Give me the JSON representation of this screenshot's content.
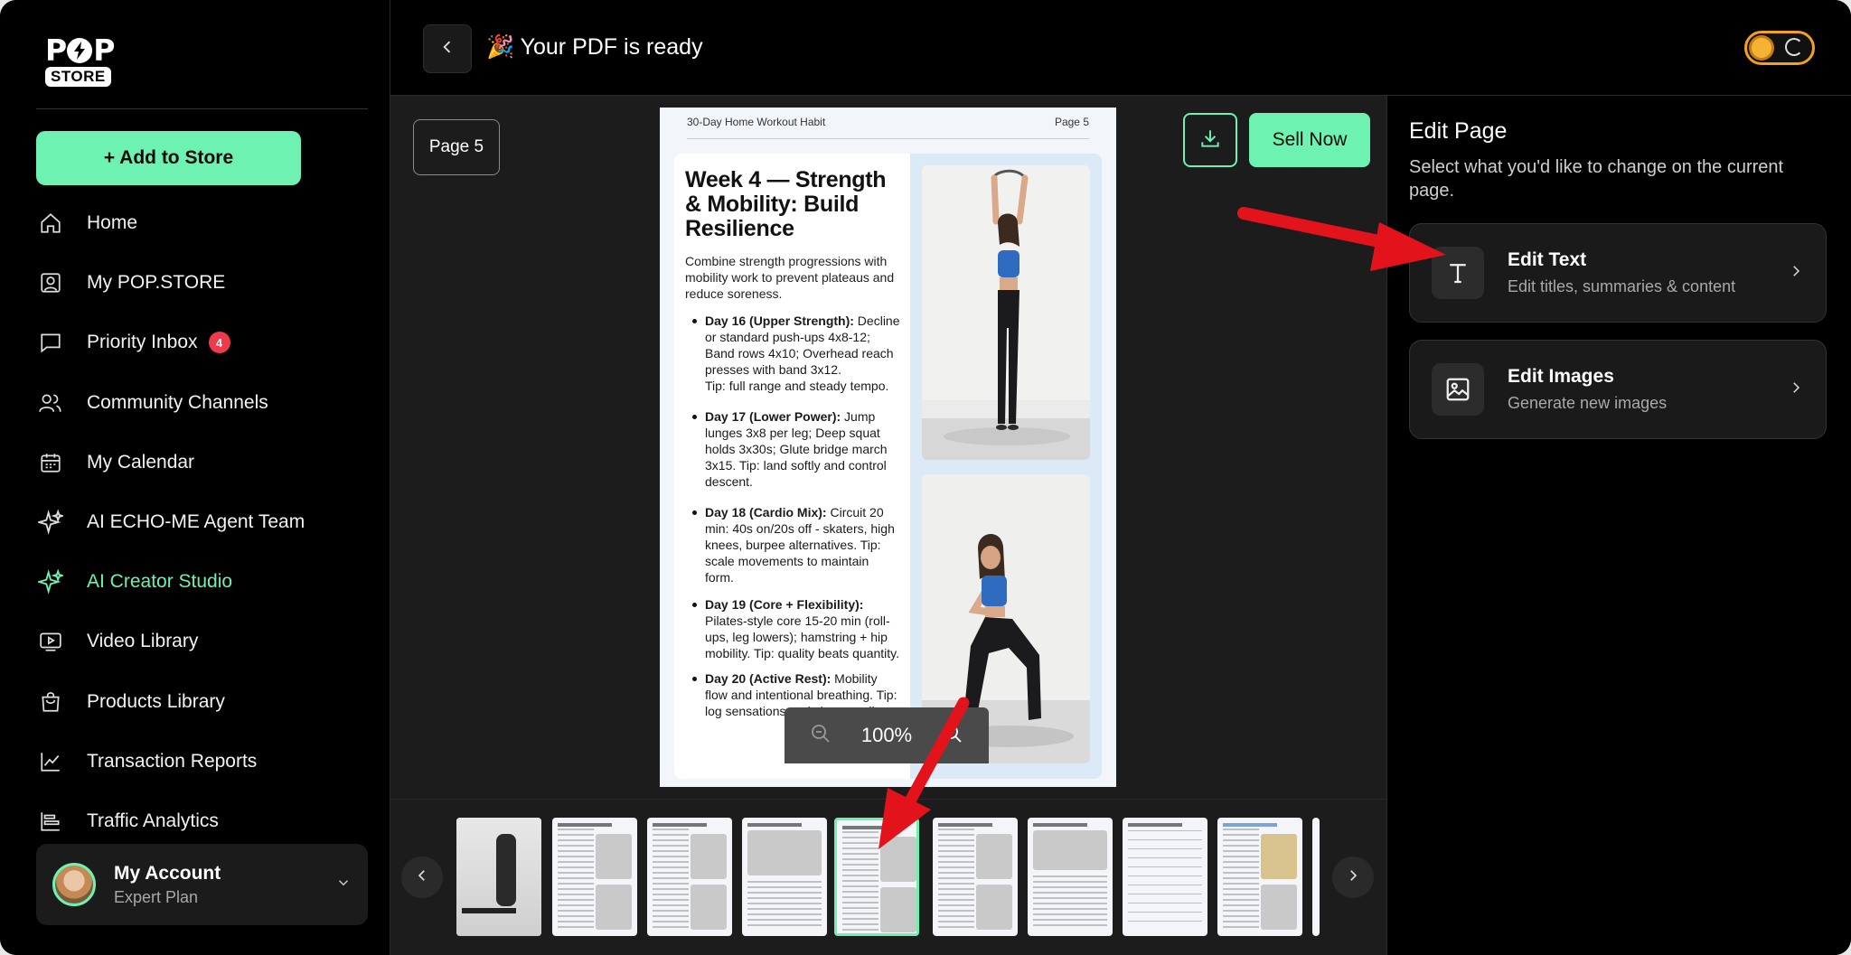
{
  "brand": {
    "logo_top": "POP",
    "logo_bottom": "STORE"
  },
  "sidebar": {
    "add_button": "+ Add to Store",
    "items": [
      {
        "label": "Home",
        "icon": "home-icon"
      },
      {
        "label": "My POP.STORE",
        "icon": "store-profile-icon"
      },
      {
        "label": "Priority Inbox",
        "icon": "chat-icon",
        "badge": "4"
      },
      {
        "label": "Community Channels",
        "icon": "users-icon"
      },
      {
        "label": "My Calendar",
        "icon": "calendar-icon"
      },
      {
        "label": "AI ECHO-ME Agent Team",
        "icon": "sparkle-icon"
      },
      {
        "label": "AI Creator Studio",
        "icon": "sparkle-icon",
        "active": true
      },
      {
        "label": "Video Library",
        "icon": "video-icon"
      },
      {
        "label": "Products Library",
        "icon": "bag-icon"
      },
      {
        "label": "Transaction Reports",
        "icon": "chart-line-icon"
      },
      {
        "label": "Traffic Analytics",
        "icon": "bar-chart-icon"
      }
    ],
    "account": {
      "name": "My Account",
      "plan": "Expert Plan"
    }
  },
  "topbar": {
    "title": "🎉 Your PDF is ready"
  },
  "viewer": {
    "page_chip": "Page 5",
    "sell_button": "Sell Now",
    "zoom": "100%"
  },
  "pdf": {
    "header_left": "30-Day Home Workout Habit",
    "header_right": "Page 5",
    "title": "Week 4 — Strength & Mobility: Build Resilience",
    "lead": "Combine strength progressions with mobility work to prevent plateaus and reduce soreness.",
    "items": [
      {
        "bold": "Day 16 (Upper Strength):",
        "text": " Decline or standard push-ups 4x8-12; Band rows 4x10; Overhead reach presses with band 3x12.",
        "tip": "Tip: full range and steady tempo."
      },
      {
        "bold": "Day 17 (Lower Power):",
        "text": " Jump lunges 3x8 per leg; Deep squat holds 3x30s; Glute bridge march 3x15. Tip: land softly and control descent.",
        "tip": ""
      },
      {
        "bold": "Day 18 (Cardio Mix):",
        "text": " Circuit 20 min: 40s on/20s off - skaters, high knees, burpee alternatives. Tip: scale movements to maintain form.",
        "tip": ""
      },
      {
        "bold": "Day 19 (Core + Flexibility):",
        "text": " Pilates-style core 15-20 min (roll-ups, leg lowers); hamstring + hip mobility. Tip: quality beats quantity.",
        "tip": ""
      },
      {
        "bold": "Day 20 (Active Rest):",
        "text": " Mobility flow and intentional breathing. Tip: log sensations and sleep quality.",
        "tip": ""
      }
    ]
  },
  "right_panel": {
    "title": "Edit Page",
    "subtitle": "Select what you'd like to change on the current page.",
    "options": [
      {
        "name": "Edit Text",
        "desc": "Edit titles, summaries & content",
        "icon": "text-icon"
      },
      {
        "name": "Edit Images",
        "desc": "Generate new images",
        "icon": "image-icon"
      }
    ]
  },
  "colors": {
    "accent": "#6ef2b1",
    "badge": "#ef3a4c",
    "arrow": "#e3131b",
    "coin": "#f4a21d"
  }
}
